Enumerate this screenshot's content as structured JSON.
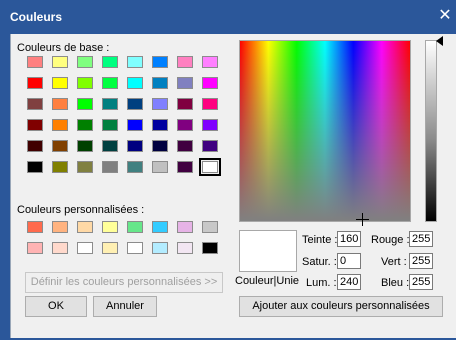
{
  "window": {
    "title": "Couleurs",
    "close_icon": "close-icon"
  },
  "labels": {
    "basic_colors": "Couleurs de base :",
    "custom_colors": "Couleurs personnalisées :",
    "color_solid": "Couleur|Unie",
    "hue": "Teinte :",
    "sat": "Satur. :",
    "lum": "Lum. :",
    "red": "Rouge :",
    "green": "Vert :",
    "blue": "Bleu :"
  },
  "values": {
    "hue": "160",
    "sat": "0",
    "lum": "240",
    "red": "255",
    "green": "255",
    "blue": "255"
  },
  "buttons": {
    "define_custom": "Définir les couleurs personnalisées >>",
    "ok": "OK",
    "cancel": "Annuler",
    "add_custom": "Ajouter aux couleurs personnalisées"
  },
  "basic_colors": [
    [
      "#ff8080",
      "#ffff80",
      "#80ff80",
      "#00ff80",
      "#80ffff",
      "#0080ff",
      "#ff80c0",
      "#ff80ff"
    ],
    [
      "#ff0000",
      "#ffff00",
      "#80ff00",
      "#00ff40",
      "#00ffff",
      "#0080c0",
      "#8080c0",
      "#ff00ff"
    ],
    [
      "#804040",
      "#ff8040",
      "#00ff00",
      "#008080",
      "#004080",
      "#8080ff",
      "#800040",
      "#ff0080"
    ],
    [
      "#800000",
      "#ff8000",
      "#008000",
      "#008040",
      "#0000ff",
      "#0000a0",
      "#800080",
      "#8000ff"
    ],
    [
      "#400000",
      "#804000",
      "#004000",
      "#004040",
      "#000080",
      "#000040",
      "#400040",
      "#400080"
    ],
    [
      "#000000",
      "#808000",
      "#808040",
      "#808080",
      "#408080",
      "#c0c0c0",
      "#400040",
      "#ffffff"
    ]
  ],
  "custom_colors": [
    [
      "#ff6a4d",
      "#ffb380",
      "#ffd9a6",
      "#ffff99",
      "#66e68a",
      "#33ccff",
      "#e6b3e6",
      "#c8c8c8"
    ],
    [
      "#ffb3b3",
      "#ffd9cc",
      "#ffffff",
      "#fff0b3",
      "#ffffff",
      "#b3ecff",
      "#f2e6f2",
      "#000000"
    ]
  ]
}
